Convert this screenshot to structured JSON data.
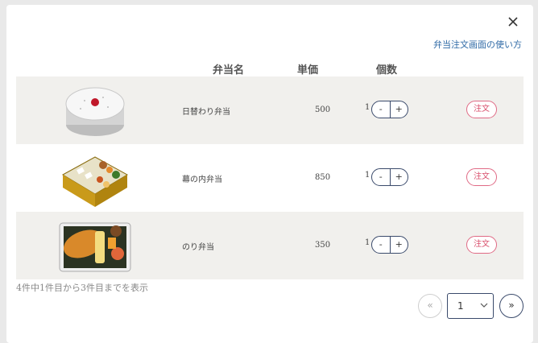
{
  "modal": {
    "help_link": "弁当注文画面の使い方",
    "close_icon": "close-icon"
  },
  "table": {
    "headers": {
      "name": "弁当名",
      "price": "単価",
      "quantity": "個数"
    },
    "rows": [
      {
        "name": "日替わり弁当",
        "price": "500",
        "quantity": "1",
        "minus": "-",
        "plus": "+",
        "order": "注文",
        "image": "bento-rice-box"
      },
      {
        "name": "幕の内弁当",
        "price": "850",
        "quantity": "1",
        "minus": "-",
        "plus": "+",
        "order": "注文",
        "image": "makunouchi-bento"
      },
      {
        "name": "のり弁当",
        "price": "350",
        "quantity": "1",
        "minus": "-",
        "plus": "+",
        "order": "注文",
        "image": "nori-bento"
      }
    ]
  },
  "footer": {
    "count_text": "4件中1件目から3件目までを表示",
    "pager_prev": "«",
    "pager_next": "»",
    "page_value": "1"
  }
}
